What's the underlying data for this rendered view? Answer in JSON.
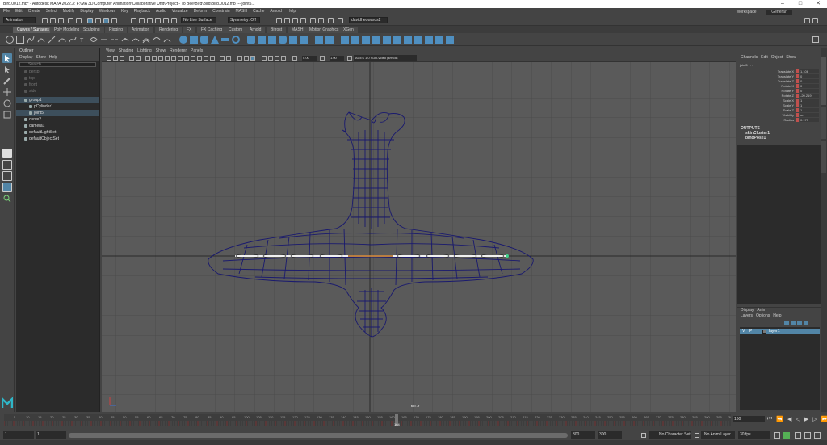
{
  "window": {
    "title": "Bird.0012.mb* - Autodesk MAYA 2022.3: F:\\MA 3D Computer Animation\\Collaborative Unit\\Project - To Bee\\Bird\\Bird\\Bird.0012.mb  ---   joint5..."
  },
  "menubar": {
    "items": [
      "File",
      "Edit",
      "Create",
      "Select",
      "Modify",
      "Display",
      "Windows",
      "Key",
      "Playback",
      "Audio",
      "Visualize",
      "Deform",
      "Constrain",
      "MASH",
      "Cache",
      "Arnold",
      "Help"
    ],
    "workspace_label": "Workspace :",
    "workspace_value": "General*"
  },
  "statusline": {
    "menuset": "Animation",
    "live_surface": "No Live Surface",
    "symmetry": "Symmetry: Off",
    "user": "davidhedwards2"
  },
  "shelf": {
    "tabs": [
      "Curves / Surfaces",
      "Poly Modeling",
      "Sculpting",
      "Rigging",
      "Animation",
      "Rendering",
      "FX",
      "FX Caching",
      "Custom",
      "Arnold",
      "Bifrost",
      "MASH",
      "Motion Graphics",
      "XGen"
    ],
    "active_tab": "Curves / Surfaces"
  },
  "outliner": {
    "title": "Outliner",
    "menu": [
      "Display",
      "Show",
      "Help"
    ],
    "search_placeholder": "Search...",
    "items": [
      {
        "label": "persp",
        "indent": 0,
        "state": "dim"
      },
      {
        "label": "top",
        "indent": 0,
        "state": "dim"
      },
      {
        "label": "front",
        "indent": 0,
        "state": "dim"
      },
      {
        "label": "side",
        "indent": 0,
        "state": "dim"
      },
      {
        "label": "group1",
        "indent": 0,
        "state": "hl"
      },
      {
        "label": "pCylinder1",
        "indent": 1,
        "state": "normal"
      },
      {
        "label": "joint5",
        "indent": 1,
        "state": "hl"
      },
      {
        "label": "curve2",
        "indent": 0,
        "state": "normal"
      },
      {
        "label": "camera1",
        "indent": 0,
        "state": "normal"
      },
      {
        "label": "defaultLightSet",
        "indent": 0,
        "state": "normal"
      },
      {
        "label": "defaultObjectSet",
        "indent": 0,
        "state": "normal"
      }
    ]
  },
  "viewport": {
    "menu": [
      "View",
      "Shading",
      "Lighting",
      "Show",
      "Renderer",
      "Panels"
    ],
    "field_a": "0.00",
    "field_b": "1.00",
    "colorspace": "ACES 1.0 SDR-video (sRGB)",
    "camera_label": "top -Y"
  },
  "channelbox": {
    "tabs": [
      "Channels",
      "Edit",
      "Object",
      "Show"
    ],
    "node": "joint5 . . .",
    "channels": [
      {
        "label": "Translate X",
        "value": "1.106"
      },
      {
        "label": "Translate Y",
        "value": "0"
      },
      {
        "label": "Translate Z",
        "value": "0"
      },
      {
        "label": "Rotate X",
        "value": "0"
      },
      {
        "label": "Rotate Y",
        "value": "0"
      },
      {
        "label": "Rotate Z",
        "value": "-20.219"
      },
      {
        "label": "Scale X",
        "value": "1"
      },
      {
        "label": "Scale Y",
        "value": "1"
      },
      {
        "label": "Scale Z",
        "value": "1"
      },
      {
        "label": "Visibility",
        "value": "on"
      },
      {
        "label": "Radius",
        "value": "0.173"
      }
    ],
    "outputs_label": "OUTPUTS",
    "outputs": [
      "skinCluster1",
      "bindPose1"
    ]
  },
  "layers": {
    "tabs": [
      "Display",
      "Anim"
    ],
    "menu": [
      "Layers",
      "Options",
      "Help"
    ],
    "layer_v": "V",
    "layer_p": "P",
    "layer_name": "layer1"
  },
  "timeslider": {
    "ticks": [
      "5",
      "10",
      "15",
      "20",
      "25",
      "30",
      "35",
      "40",
      "45",
      "50",
      "55",
      "60",
      "65",
      "70",
      "75",
      "80",
      "85",
      "90",
      "95",
      "100",
      "105",
      "110",
      "115",
      "120",
      "125",
      "130",
      "135",
      "140",
      "145",
      "150",
      "155",
      "160",
      "165",
      "170",
      "175",
      "180",
      "185",
      "190",
      "195",
      "200",
      "205",
      "210",
      "215",
      "220",
      "225",
      "230",
      "235",
      "240",
      "245",
      "250",
      "255",
      "260",
      "265",
      "270",
      "275",
      "280",
      "285",
      "290",
      "295",
      "300"
    ],
    "current_frame": "164",
    "current_frame_field": "160",
    "current_fraction": 0.54
  },
  "rangeslider": {
    "start": "1",
    "start_inner": "1",
    "end_inner": "300",
    "end": "300",
    "char_set": "No Character Set",
    "anim_layer": "No Anim Layer",
    "fps": "30 fps"
  },
  "colors": {
    "selection": "#5285a6",
    "wireframe": "#1a1a6e",
    "key_red": "#c0504d"
  }
}
